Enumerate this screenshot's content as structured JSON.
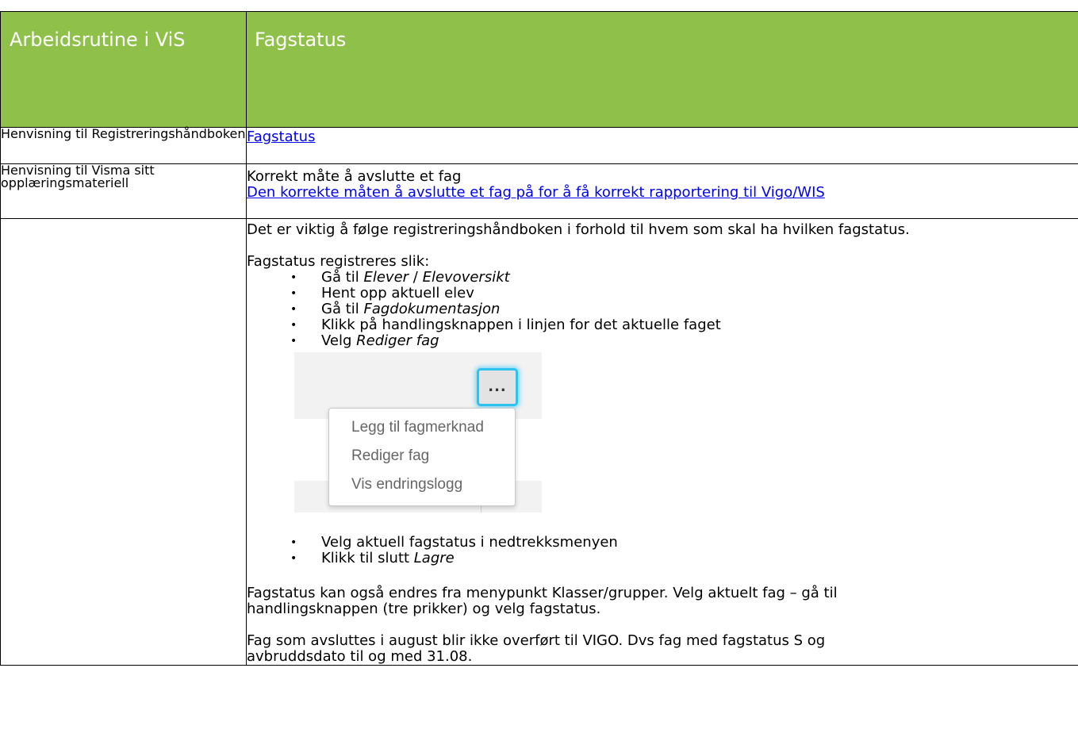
{
  "header": {
    "left": "Arbeidsrutine i ViS",
    "right": "Fagstatus"
  },
  "rows": {
    "ref": {
      "label": "Henvisning til Registreringshåndboken",
      "link": "Fagstatus"
    },
    "visma": {
      "label": "Henvisning til Visma sitt opplæringsmateriell",
      "title": "Korrekt måte å avslutte et fag",
      "link": "Den korrekte måten å avslutte et fag på for å få korrekt rapportering til Vigo/WIS"
    },
    "main": {
      "intro": "Det er viktig å følge registreringshåndboken i forhold til hvem som skal ha hvilken fagstatus.",
      "steps_title": "Fagstatus registreres slik:",
      "steps": [
        {
          "pre": "Gå til ",
          "em": "Elever",
          "mid": " / ",
          "em2": "Elevoversikt"
        },
        {
          "pre": "Hent opp aktuell elev"
        },
        {
          "pre": "Gå til ",
          "em": "Fagdokumentasjon"
        },
        {
          "pre": "Klikk på handlingsknappen i linjen for det aktuelle faget"
        },
        {
          "pre": "Velg ",
          "em": "Rediger fag"
        }
      ],
      "screenshot": {
        "button": "...",
        "menu": [
          "Legg til fagmerknad",
          "Rediger fag",
          "Vis endringslogg"
        ]
      },
      "steps2": [
        {
          "pre": "Velg aktuell fagstatus i nedtrekksmenyen"
        },
        {
          "pre": "Klikk til slutt ",
          "em": "Lagre"
        }
      ],
      "para1": "Fagstatus kan også endres fra menypunkt Klasser/grupper. Velg aktuelt fag – gå til handlingsknappen (tre prikker) og velg fagstatus.",
      "para2": "Fag som avsluttes i august blir ikke overført til VIGO. Dvs fag med fagstatus S og avbruddsdato til og med 31.08."
    }
  },
  "colors": {
    "header_bg": "#8fc04a",
    "link": "#0000ee",
    "focus_ring": "#2ec2f0"
  }
}
